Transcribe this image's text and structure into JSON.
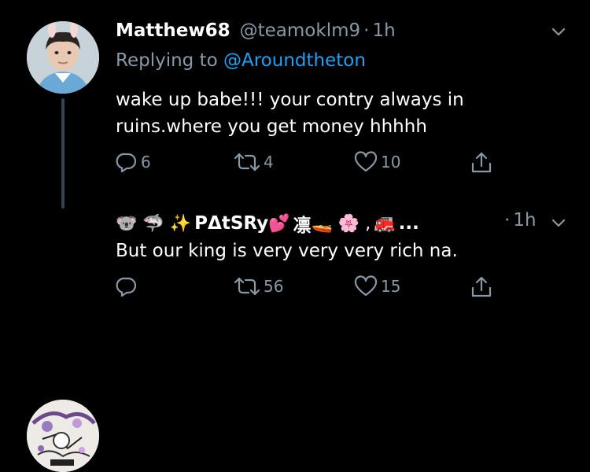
{
  "tweet1": {
    "name": "Matthew68",
    "handle": "@teamoklm9",
    "separator": "·",
    "time": "1h",
    "replying_prefix": "Replying to",
    "replying_mention": "@Aroundtheton",
    "text_line1": "wake up babe!!! your contry always in",
    "text_line2": "ruins.where you get money hhhhh",
    "replies": "6",
    "retweets": "4",
    "likes": "10"
  },
  "tweet2": {
    "name_prefix_emoji": "🐨 🦈 ✨",
    "name": "PΔtSRy",
    "name_emoji_1": "💕",
    "name_char": "凛",
    "name_emoji_2": "🚤 🌸 ,",
    "name_emoji_3": "🚒",
    "name_ellipsis": "...",
    "separator": "·",
    "time": "1h",
    "text": "But our king is very very very rich na.",
    "retweets": "56",
    "likes": "15"
  },
  "icons": {
    "reply": "reply-icon",
    "retweet": "retweet-icon",
    "like": "heart-icon",
    "share": "share-icon",
    "more": "chevron-down-icon"
  },
  "colors": {
    "background": "#000000",
    "muted": "#8899a6",
    "link": "#1da1f2",
    "thread_line": "#38444d"
  }
}
